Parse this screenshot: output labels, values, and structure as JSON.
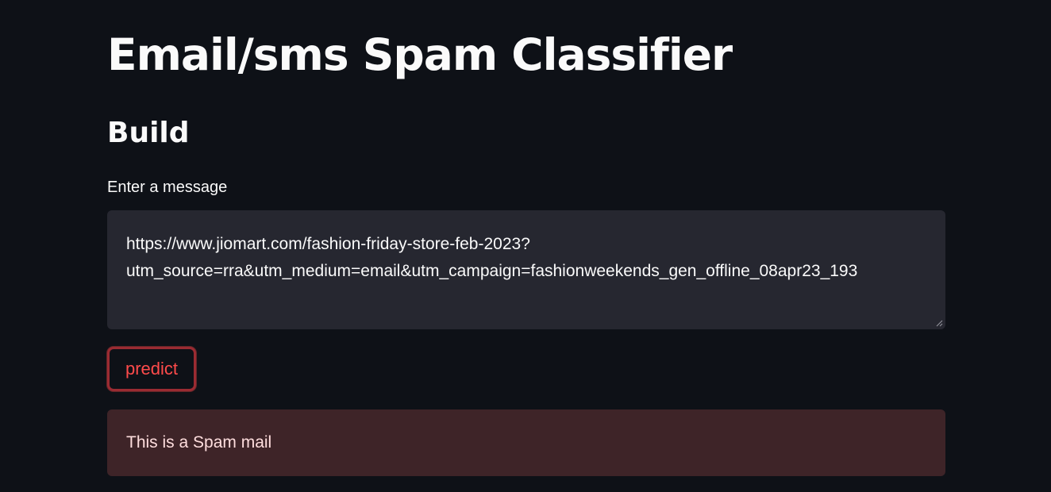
{
  "app": {
    "title": "Email/sms Spam Classifier",
    "subheader": "Build"
  },
  "form": {
    "message_label": "Enter a message",
    "message_value_lines": [
      " https://www.jiomart.com/fashion-friday-store-feb-2023?",
      "utm_source=rra&utm_medium=email&utm_campaign=fashionweekends_gen_offline_08apr23_193"
    ],
    "predict_label": "predict"
  },
  "result": {
    "text": "This is a Spam mail"
  },
  "colors": {
    "background": "#0e1117",
    "input_background": "#262730",
    "primary": "#ff4b4b",
    "error_background": "#3e2428",
    "error_text": "#ffdede"
  }
}
